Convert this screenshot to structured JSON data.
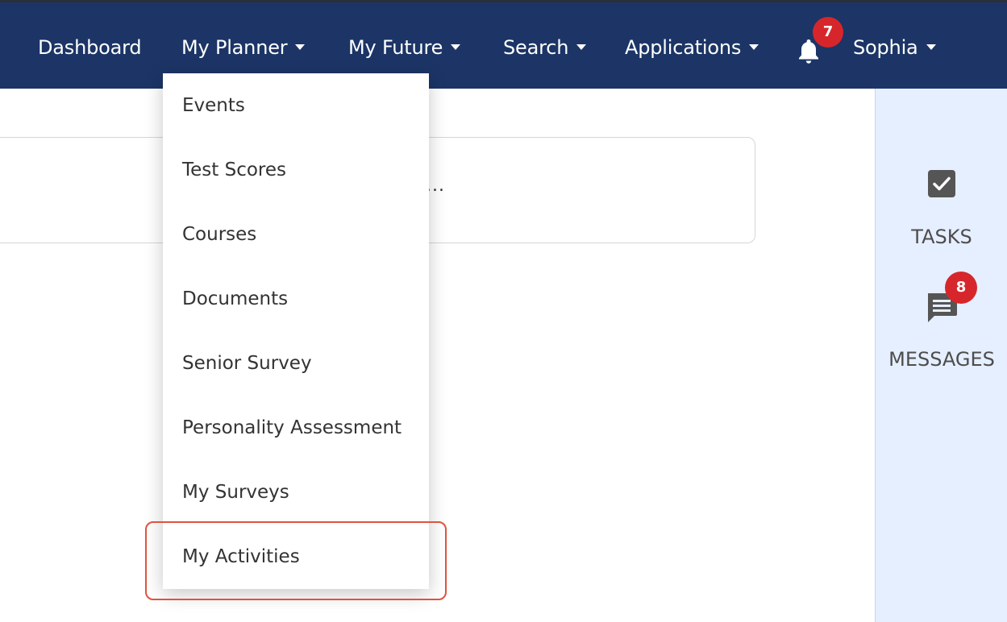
{
  "nav": {
    "dashboard": "Dashboard",
    "my_planner": "My Planner",
    "my_future": "My Future",
    "search": "Search",
    "applications": "Applications",
    "notifications_count": "7",
    "user": "Sophia"
  },
  "dropdown": {
    "items": [
      "Events",
      "Test Scores",
      "Courses",
      "Documents",
      "Senior Survey",
      "Personality Assessment",
      "My Surveys",
      "My Activities"
    ],
    "highlighted": "My Activities"
  },
  "content": {
    "ellipsis": "..."
  },
  "side_panel": {
    "tasks_label": "TASKS",
    "messages_label": "MESSAGES",
    "messages_count": "8"
  },
  "colors": {
    "topbar": "#1c3566",
    "badge": "#d7262b",
    "side_panel": "#e6efff",
    "highlight": "#e0533d"
  },
  "icons": {
    "notifications": "bell-icon",
    "tasks": "checkbox-icon",
    "messages": "chat-bubble-icon"
  }
}
